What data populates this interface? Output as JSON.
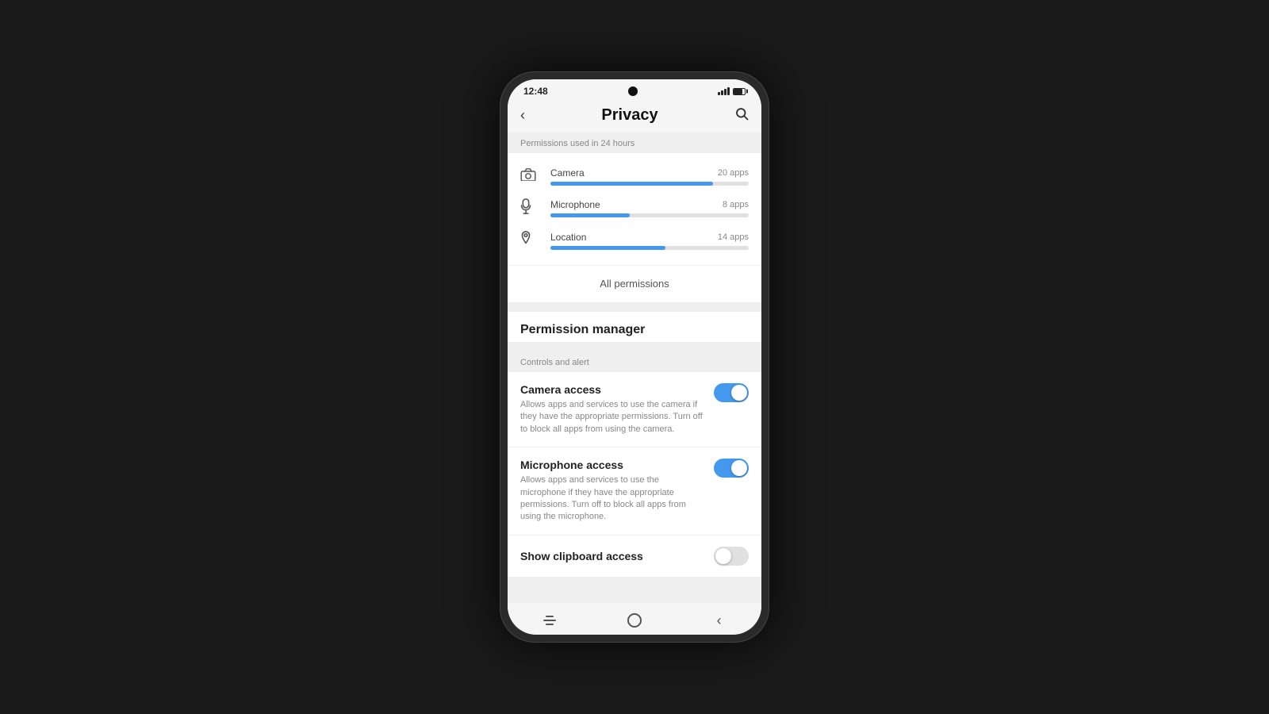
{
  "status": {
    "time": "12:48"
  },
  "header": {
    "title": "Privacy",
    "back_label": "‹",
    "search_label": "🔍"
  },
  "permissions_section": {
    "label": "Permissions used in 24 hours",
    "permissions": [
      {
        "name": "Camera",
        "count": "20 apps",
        "bar_width": "82%",
        "icon": "📷"
      },
      {
        "name": "Microphone",
        "count": "8 apps",
        "bar_width": "40%",
        "icon": "🎤"
      },
      {
        "name": "Location",
        "count": "14 apps",
        "bar_width": "58%",
        "icon": "📍"
      }
    ],
    "all_permissions_label": "All permissions"
  },
  "permission_manager": {
    "title": "Permission manager"
  },
  "controls": {
    "label": "Controls and alert",
    "items": [
      {
        "title": "Camera access",
        "desc": "Allows apps and services to use the camera if they have the appropriate permissions. Turn off to block all apps from using the camera.",
        "enabled": true
      },
      {
        "title": "Microphone access",
        "desc": "Allows apps and services to use the microphone if they have the appropriate permissions. Turn off to block all apps from using the microphone.",
        "enabled": true
      },
      {
        "title": "Show clipboard access",
        "desc": "",
        "enabled": false
      }
    ]
  },
  "nav": {
    "home": "○",
    "back": "‹"
  }
}
